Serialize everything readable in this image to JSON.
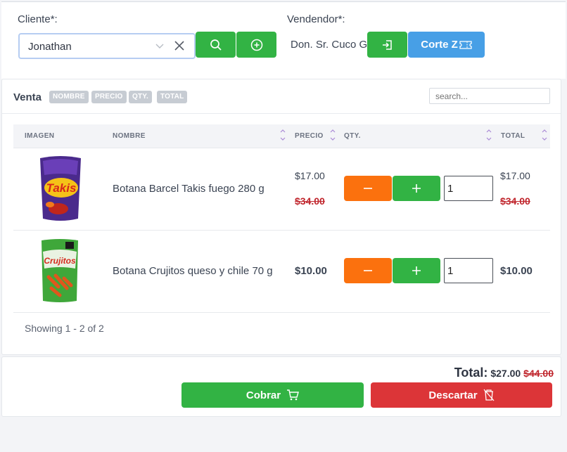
{
  "header": {
    "cliente_label": "Cliente*:",
    "cliente_value": "Jonathan",
    "vendedor_label": "Vendendor*:",
    "vendedor_value": "Don. Sr. Cuco G.",
    "corte_label": "Corte Z"
  },
  "venta": {
    "title": "Venta",
    "chips": [
      "NOMBRE",
      "PRECIO",
      "QTY.",
      "TOTAL"
    ],
    "search_placeholder": "search...",
    "columns": {
      "imagen": "IMAGEN",
      "nombre": "NOMBRE",
      "precio": "PRECIO",
      "qty": "QTY.",
      "total": "TOTAL"
    },
    "rows": [
      {
        "image": "takis-bag",
        "nombre": "Botana Barcel Takis fuego 280 g",
        "precio": "$17.00",
        "precio_original": "$34.00",
        "qty": "1",
        "total": "$17.00",
        "total_original": "$34.00"
      },
      {
        "image": "crujitos-bag",
        "nombre": "Botana Crujitos queso y chile 70 g",
        "precio": "$10.00",
        "qty": "1",
        "total": "$10.00"
      }
    ],
    "showing": "Showing 1 - 2 of 2"
  },
  "footer": {
    "total_label": "Total:",
    "total_value": "$27.00",
    "total_original": "$44.00",
    "cobrar_label": "Cobrar",
    "descartar_label": "Descartar"
  },
  "colors": {
    "green": "#32b344",
    "blue": "#479fe6",
    "orange": "#fb710e",
    "red": "#dc3538",
    "strike_red": "#c0262d"
  }
}
